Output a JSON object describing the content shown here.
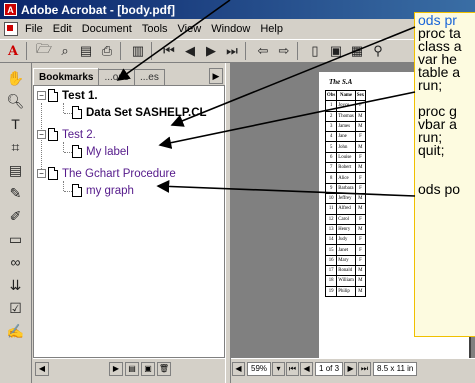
{
  "window": {
    "title": "Adobe Acrobat - [body.pdf]"
  },
  "menu": [
    "File",
    "Edit",
    "Document",
    "Tools",
    "View",
    "Window",
    "Help"
  ],
  "panel": {
    "tabs": [
      "Bookmarks",
      "Thumbnails",
      "Signatures"
    ],
    "visible_tabs": [
      "Bookmarks",
      "...ons",
      "...es"
    ]
  },
  "bookmarks": [
    {
      "label": "Test 1.",
      "level": 0,
      "style": "bold"
    },
    {
      "label": "Data Set SASHELP.CL",
      "level": 1,
      "style": "bold"
    },
    {
      "label": "Test 2.",
      "level": 0,
      "style": "purple"
    },
    {
      "label": "My label",
      "level": 1,
      "style": "purple"
    },
    {
      "label": "The Gchart Procedure",
      "level": 0,
      "style": "purple"
    },
    {
      "label": "my graph",
      "level": 1,
      "style": "purple"
    }
  ],
  "document": {
    "heading": "The S.A",
    "table_headers": [
      "Obs",
      "Name",
      "Sex"
    ],
    "rows": [
      [
        "1",
        "Joyce",
        "F"
      ],
      [
        "2",
        "Thomas",
        "M"
      ],
      [
        "3",
        "James",
        "M"
      ],
      [
        "4",
        "Jane",
        "F"
      ],
      [
        "5",
        "John",
        "M"
      ],
      [
        "6",
        "Louise",
        "F"
      ],
      [
        "7",
        "Robert",
        "M"
      ],
      [
        "8",
        "Alice",
        "F"
      ],
      [
        "9",
        "Barbara",
        "F"
      ],
      [
        "10",
        "Jeffrey",
        "M"
      ],
      [
        "11",
        "Alfred",
        "M"
      ],
      [
        "12",
        "Carol",
        "F"
      ],
      [
        "13",
        "Henry",
        "M"
      ],
      [
        "14",
        "Judy",
        "F"
      ],
      [
        "15",
        "Janet",
        "F"
      ],
      [
        "16",
        "Mary",
        "F"
      ],
      [
        "17",
        "Ronald",
        "M"
      ],
      [
        "18",
        "William",
        "M"
      ],
      [
        "19",
        "Philip",
        "M"
      ]
    ]
  },
  "statusbar": {
    "zoom": "59%",
    "page": "1 of 3",
    "size": "8.5 x 11 in"
  },
  "callout": {
    "lines": [
      "ods pr",
      "proc ta",
      "class a",
      "var he",
      "table a",
      "run;",
      "",
      "proc g",
      "vbar a",
      "run;",
      "quit;",
      "",
      "",
      "ods po"
    ]
  },
  "colors": {
    "accent": "#0a246a",
    "callout_bg": "#fdfbe0",
    "visited": "#551a8b"
  }
}
